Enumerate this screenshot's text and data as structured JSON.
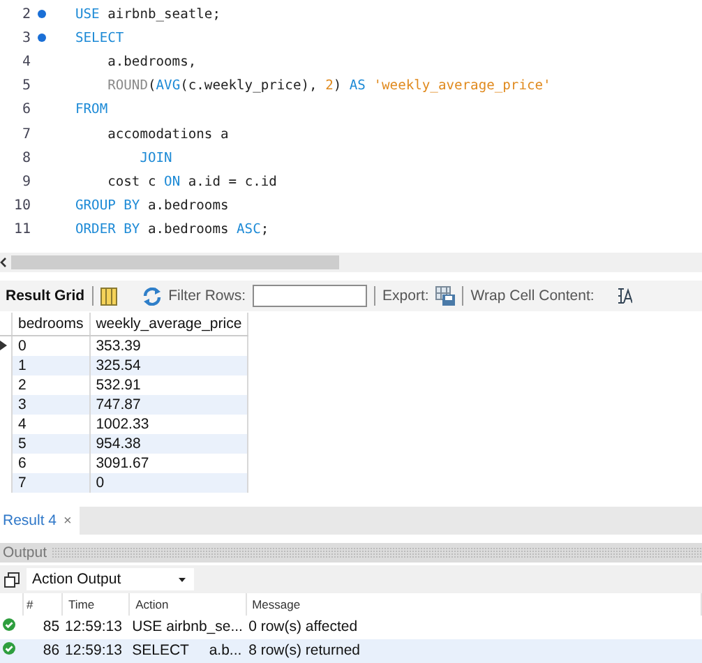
{
  "editor": {
    "lines": [
      {
        "number": "2",
        "marker": true,
        "tokens": [
          {
            "kind": "keyword",
            "text": "USE"
          },
          {
            "kind": "plain",
            "text": " airbnb_seatle;"
          }
        ]
      },
      {
        "number": "3",
        "marker": true,
        "tokens": [
          {
            "kind": "keyword",
            "text": "SELECT"
          }
        ]
      },
      {
        "number": "4",
        "marker": false,
        "tokens": [
          {
            "kind": "plain",
            "text": "    a.bedrooms,"
          }
        ]
      },
      {
        "number": "5",
        "marker": false,
        "tokens": [
          {
            "kind": "function",
            "text": "    ROUND"
          },
          {
            "kind": "plain",
            "text": "("
          },
          {
            "kind": "keyword",
            "text": "AVG"
          },
          {
            "kind": "plain",
            "text": "(c.weekly_price), "
          },
          {
            "kind": "number",
            "text": "2"
          },
          {
            "kind": "plain",
            "text": ") "
          },
          {
            "kind": "keyword",
            "text": "AS"
          },
          {
            "kind": "string",
            "text": " 'weekly_average_price'"
          }
        ]
      },
      {
        "number": "6",
        "marker": false,
        "tokens": [
          {
            "kind": "keyword",
            "text": "FROM"
          }
        ]
      },
      {
        "number": "7",
        "marker": false,
        "tokens": [
          {
            "kind": "plain",
            "text": "    accomodations a"
          }
        ]
      },
      {
        "number": "8",
        "marker": false,
        "tokens": [
          {
            "kind": "keyword",
            "text": "        JOIN"
          }
        ]
      },
      {
        "number": "9",
        "marker": false,
        "tokens": [
          {
            "kind": "plain",
            "text": "    cost c "
          },
          {
            "kind": "keyword",
            "text": "ON"
          },
          {
            "kind": "plain",
            "text": " a.id = c.id"
          }
        ]
      },
      {
        "number": "10",
        "marker": false,
        "tokens": [
          {
            "kind": "keyword",
            "text": "GROUP BY"
          },
          {
            "kind": "plain",
            "text": " a.bedrooms"
          }
        ]
      },
      {
        "number": "11",
        "marker": false,
        "tokens": [
          {
            "kind": "keyword",
            "text": "ORDER BY"
          },
          {
            "kind": "plain",
            "text": " a.bedrooms "
          },
          {
            "kind": "keyword",
            "text": "ASC"
          },
          {
            "kind": "plain",
            "text": ";"
          }
        ]
      }
    ]
  },
  "toolbar": {
    "result_grid": "Result Grid",
    "filter_label": "Filter Rows:",
    "export_label": "Export:",
    "wrap_label": "Wrap Cell Content:"
  },
  "grid": {
    "columns": [
      "bedrooms",
      "weekly_average_price"
    ],
    "rows": [
      {
        "cells": [
          "0",
          "353.39"
        ],
        "current": true
      },
      {
        "cells": [
          "1",
          "325.54"
        ],
        "current": false
      },
      {
        "cells": [
          "2",
          "532.91"
        ],
        "current": false
      },
      {
        "cells": [
          "3",
          "747.87"
        ],
        "current": false
      },
      {
        "cells": [
          "4",
          "1002.33"
        ],
        "current": false
      },
      {
        "cells": [
          "5",
          "954.38"
        ],
        "current": false
      },
      {
        "cells": [
          "6",
          "3091.67"
        ],
        "current": false
      },
      {
        "cells": [
          "7",
          "0"
        ],
        "current": false
      }
    ]
  },
  "result_tabs": [
    {
      "label": "Result 4",
      "close": "×",
      "selected": true
    }
  ],
  "output": {
    "title": "Output",
    "dropdown": "Action Output",
    "columns": [
      "#",
      "Time",
      "Action",
      "Message"
    ],
    "rows": [
      {
        "kind": "success",
        "selected": false,
        "cells": [
          "85",
          "12:59:13",
          "USE airbnb_se...",
          "0 row(s) affected"
        ]
      },
      {
        "kind": "success",
        "selected": true,
        "cells": [
          "86",
          "12:59:13",
          "SELECT     a.b...",
          "8 row(s) returned"
        ]
      }
    ]
  }
}
